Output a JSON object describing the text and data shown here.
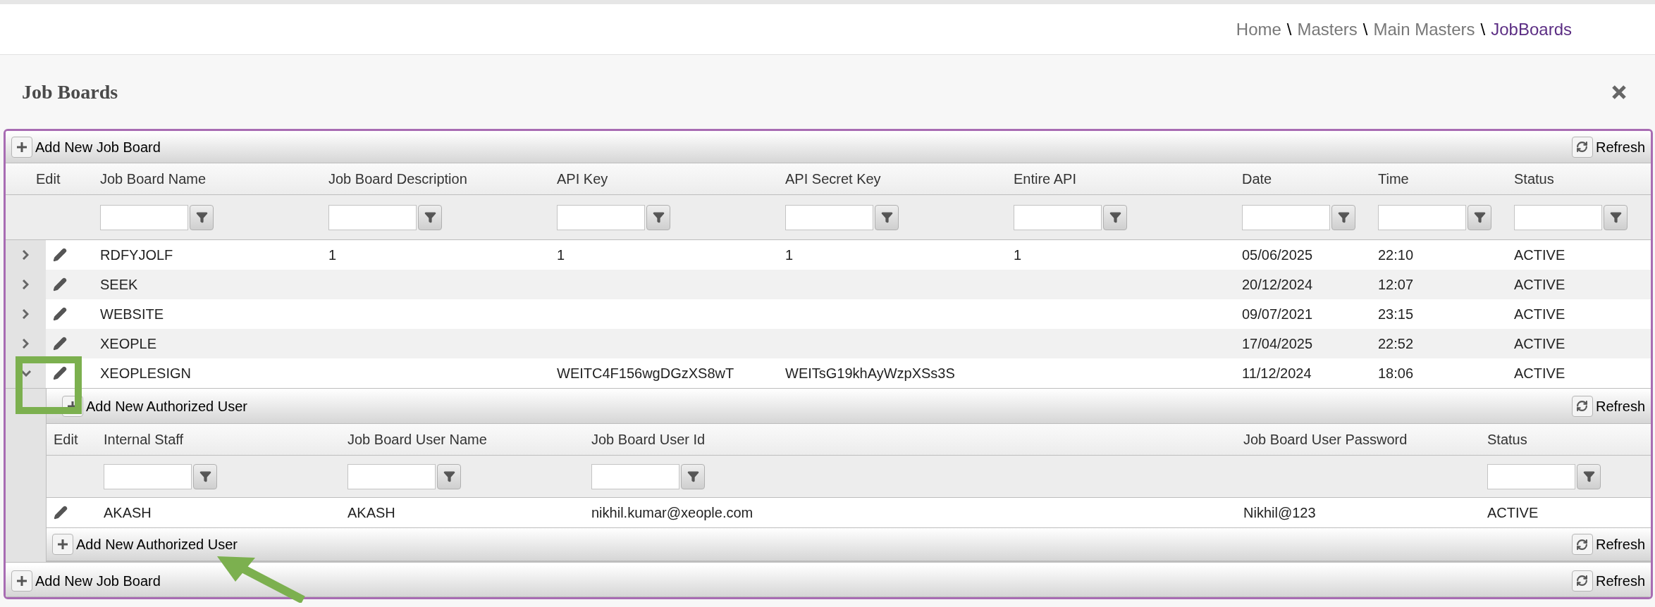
{
  "breadcrumb": [
    {
      "label": "Home",
      "current": false
    },
    {
      "separator": "\\",
      "label": "Masters",
      "current": false
    },
    {
      "separator": "\\",
      "label": "Main Masters",
      "current": false
    },
    {
      "separator": "\\",
      "label": "JobBoards",
      "current": true
    }
  ],
  "panel": {
    "title": "Job Boards"
  },
  "grid": {
    "top_toolbar": {
      "add": "Add New Job Board",
      "refresh": "Refresh"
    },
    "columns": [
      {
        "label": "Edit",
        "filter": false
      },
      {
        "label": "Job Board Name",
        "filter": true
      },
      {
        "label": "Job Board Description",
        "filter": true
      },
      {
        "label": "API Key",
        "filter": true
      },
      {
        "label": "API Secret Key",
        "filter": true
      },
      {
        "label": "Entire API",
        "filter": true
      },
      {
        "label": "Date",
        "filter": true
      },
      {
        "label": "Time",
        "filter": true
      },
      {
        "label": "Status",
        "filter": true
      }
    ],
    "rows": [
      {
        "expanded": false,
        "cells": [
          "",
          "RDFYJOLF",
          "1",
          "1",
          "1",
          "1",
          "05/06/2025",
          "22:10",
          "ACTIVE"
        ]
      },
      {
        "expanded": false,
        "cells": [
          "",
          "SEEK",
          "",
          "",
          "",
          "",
          "20/12/2024",
          "12:07",
          "ACTIVE"
        ]
      },
      {
        "expanded": false,
        "cells": [
          "",
          "WEBSITE",
          "",
          "",
          "",
          "",
          "09/07/2021",
          "23:15",
          "ACTIVE"
        ]
      },
      {
        "expanded": false,
        "cells": [
          "",
          "XEOPLE",
          "",
          "",
          "",
          "",
          "17/04/2025",
          "22:52",
          "ACTIVE"
        ]
      },
      {
        "expanded": true,
        "cells": [
          "",
          "XEOPLESIGN",
          "",
          "WEITC4F156wgDGzXS8wT",
          "WEITsG19khAyWzpXSs3S",
          "",
          "11/12/2024",
          "18:06",
          "ACTIVE"
        ]
      }
    ],
    "detail": {
      "top_toolbar": {
        "add": "Add New Authorized User",
        "refresh": "Refresh"
      },
      "columns": [
        {
          "label": "Edit",
          "filter": false
        },
        {
          "label": "Internal Staff",
          "filter": true
        },
        {
          "label": "Job Board User Name",
          "filter": true
        },
        {
          "label": "Job Board User Id",
          "filter": true
        },
        {
          "label": "Job Board User Password",
          "filter": false
        },
        {
          "label": "Status",
          "filter": true
        }
      ],
      "rows": [
        {
          "cells": [
            "",
            "AKASH",
            "AKASH",
            "nikhil.kumar@xeople.com",
            "Nikhil@123",
            "ACTIVE"
          ]
        }
      ],
      "bottom_toolbar": {
        "add": "Add New Authorized User",
        "refresh": "Refresh"
      }
    },
    "bottom_toolbar": {
      "add": "Add New Job Board",
      "refresh": "Refresh"
    }
  }
}
